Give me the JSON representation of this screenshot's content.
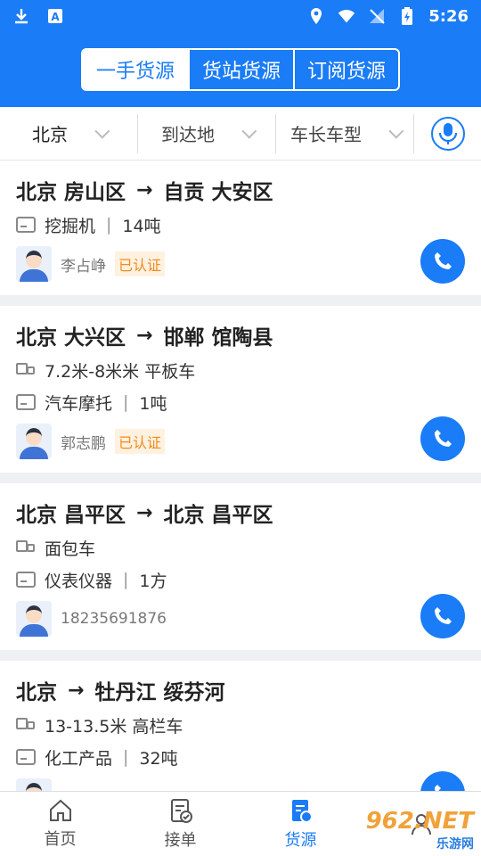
{
  "statusbar": {
    "time": "5:26"
  },
  "header": {
    "tabs": [
      "一手货源",
      "货站货源",
      "订阅货源"
    ]
  },
  "filters": {
    "origin": "北京",
    "destination": "到达地",
    "vehicle": "车长车型"
  },
  "cards": [
    {
      "from": "北京 房山区",
      "arrow": "→",
      "to": "自贡 大安区",
      "truck": null,
      "cargo": "挖掘机",
      "amount": "14吨",
      "contact": "李占峥",
      "verified": "已认证"
    },
    {
      "from": "北京 大兴区",
      "arrow": "→",
      "to": "邯郸 馆陶县",
      "truck": "7.2米-8米米 平板车",
      "cargo": "汽车摩托",
      "amount": "1吨",
      "contact": "郭志鹏",
      "verified": "已认证"
    },
    {
      "from": "北京 昌平区",
      "arrow": "→",
      "to": "北京 昌平区",
      "truck": "面包车",
      "cargo": "仪表仪器",
      "amount": "1方",
      "contact": "18235691876",
      "verified": null
    },
    {
      "from": "北京",
      "arrow": "→",
      "to": "牡丹江 绥芬河",
      "truck": "13-13.5米 高栏车",
      "cargo": "化工产品",
      "amount": "32吨",
      "contact": "",
      "verified": null
    }
  ],
  "bottomnav": {
    "items": [
      "首页",
      "接单",
      "货源"
    ]
  },
  "watermark": {
    "main": "962.NET",
    "sub": "乐游网"
  },
  "colors": {
    "brand": "#1a7cf6",
    "verified": "#f08a1c"
  }
}
